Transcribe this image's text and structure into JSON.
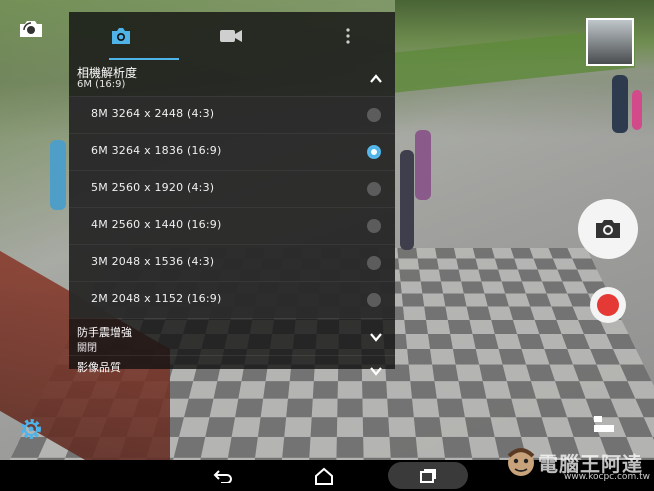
{
  "settings_panel": {
    "tabs": [
      {
        "icon": "camera-icon",
        "selected": true
      },
      {
        "icon": "video-camera-icon",
        "selected": false
      }
    ],
    "resolution": {
      "title": "相機解析度",
      "current": "6M (16:9)",
      "expanded": true,
      "options": [
        {
          "label": "8M  3264 x 2448  (4:3)",
          "checked": false
        },
        {
          "label": "6M  3264 x 1836  (16:9)",
          "checked": true
        },
        {
          "label": "5M  2560 x 1920  (4:3)",
          "checked": false
        },
        {
          "label": "4M  2560 x 1440  (16:9)",
          "checked": false
        },
        {
          "label": "3M  2048 x 1536  (4:3)",
          "checked": false
        },
        {
          "label": "2M  2048 x 1152  (16:9)",
          "checked": false
        }
      ]
    },
    "stabilization": {
      "title": "防手震增強",
      "value": "關閉"
    },
    "quality": {
      "title": "影像品質"
    }
  },
  "watermark": {
    "text": "電腦王阿達",
    "url": "www.kocpc.com.tw"
  },
  "colors": {
    "accent": "#4fb3e8",
    "record": "#e53935",
    "panel": "#141414"
  }
}
